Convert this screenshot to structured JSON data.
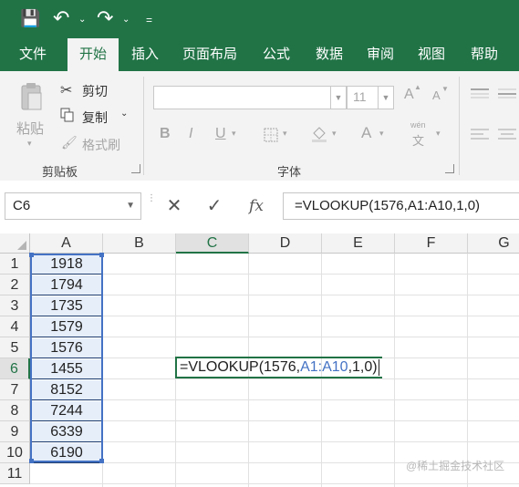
{
  "quick_access": {
    "save_glyph": "💾",
    "undo_glyph": "↶",
    "redo_glyph": "↷",
    "dropdown_glyph": "⌄",
    "customize_glyph": "="
  },
  "tabs": [
    "文件",
    "开始",
    "插入",
    "页面布局",
    "公式",
    "数据",
    "审阅",
    "视图",
    "帮助"
  ],
  "active_tab": "开始",
  "ribbon": {
    "clipboard": {
      "paste": "粘贴",
      "cut": "剪切",
      "copy": "复制",
      "format_painter": "格式刷",
      "group_label": "剪贴板"
    },
    "font": {
      "font_name": "",
      "font_size": "11",
      "grow_glyph": "A",
      "shrink_glyph": "A",
      "bold": "B",
      "italic": "I",
      "underline": "U",
      "font_color_glyph": "A",
      "phonetic": "wén",
      "phonetic_char": "文",
      "group_label": "字体"
    }
  },
  "formula_bar": {
    "name_box": "C6",
    "cancel_glyph": "✕",
    "enter_glyph": "✓",
    "fx_glyph": "fx",
    "formula": "=VLOOKUP(1576,A1:A10,1,0)"
  },
  "grid": {
    "columns": [
      "A",
      "B",
      "C",
      "D",
      "E",
      "F",
      "G"
    ],
    "selected_column": "C",
    "rows": [
      "1",
      "2",
      "3",
      "4",
      "5",
      "6",
      "7",
      "8",
      "9",
      "10",
      "11"
    ],
    "selected_row": "6",
    "column_a_values": [
      "1918",
      "1794",
      "1735",
      "1579",
      "1576",
      "1455",
      "8152",
      "7244",
      "6339",
      "6190"
    ],
    "editing_cell": {
      "prefix": "=VLOOKUP(1576,",
      "reference": "A1:A10",
      "suffix": ",1,0)"
    }
  },
  "watermark": "@稀土掘金技术社区",
  "colors": {
    "excel_green": "#217346",
    "range_blue": "#4472c4",
    "ribbon_bg": "#f3f3f3"
  }
}
